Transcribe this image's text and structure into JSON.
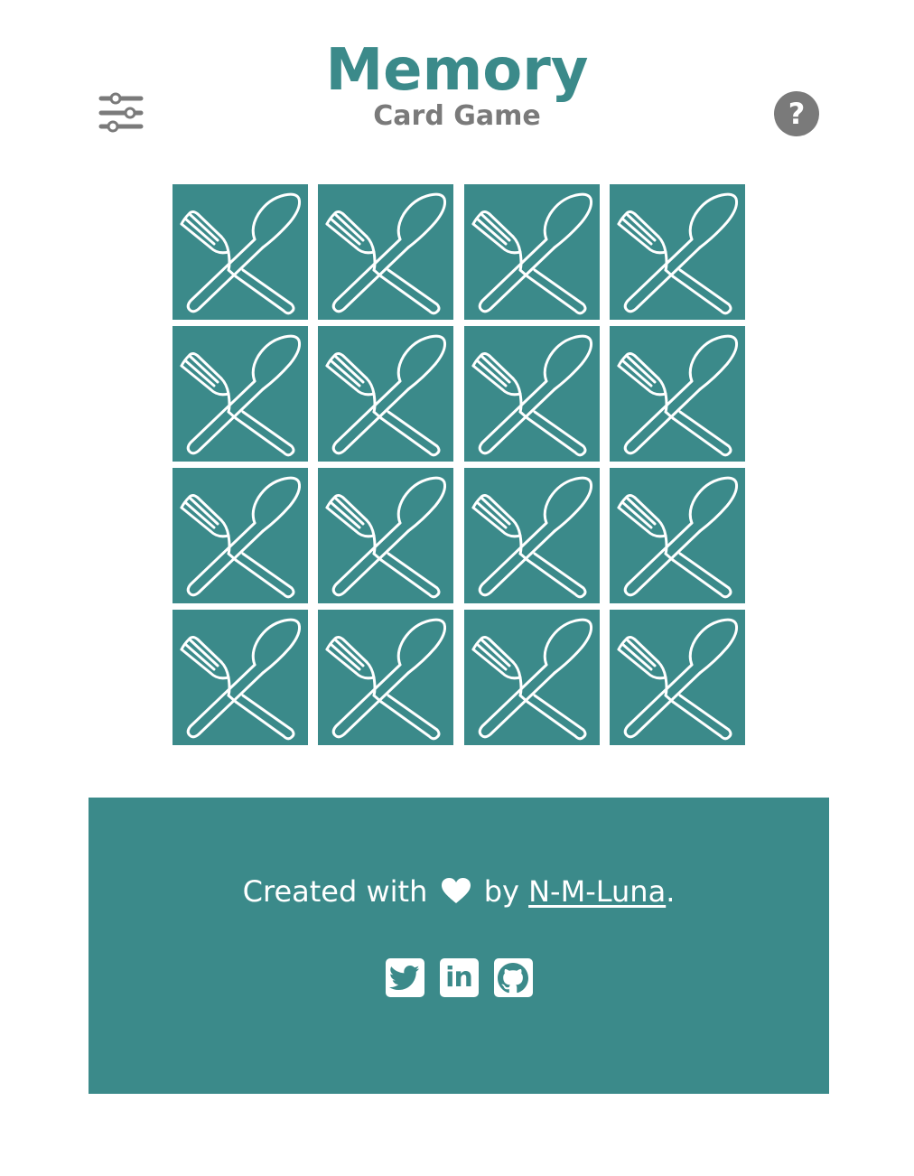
{
  "header": {
    "title": "Memory",
    "subtitle": "Card Game",
    "settings_icon": "sliders-icon",
    "help_label": "?"
  },
  "board": {
    "rows": 4,
    "columns": 4,
    "card_face": "fork-and-spoon-icon",
    "cards": [
      {
        "state": "face-down"
      },
      {
        "state": "face-down"
      },
      {
        "state": "face-down"
      },
      {
        "state": "face-down"
      },
      {
        "state": "face-down"
      },
      {
        "state": "face-down"
      },
      {
        "state": "face-down"
      },
      {
        "state": "face-down"
      },
      {
        "state": "face-down"
      },
      {
        "state": "face-down"
      },
      {
        "state": "face-down"
      },
      {
        "state": "face-down"
      },
      {
        "state": "face-down"
      },
      {
        "state": "face-down"
      },
      {
        "state": "face-down"
      },
      {
        "state": "face-down"
      }
    ]
  },
  "footer": {
    "credit_prefix": "Created with",
    "credit_by": "by",
    "author_link": "N-M-Luna",
    "credit_suffix": ".",
    "socials": [
      {
        "name": "twitter-icon"
      },
      {
        "name": "linkedin-icon",
        "label": "in"
      },
      {
        "name": "github-icon"
      }
    ]
  },
  "colors": {
    "accent": "#3b8a8a",
    "muted": "#7a7a7a",
    "background": "#ffffff"
  }
}
